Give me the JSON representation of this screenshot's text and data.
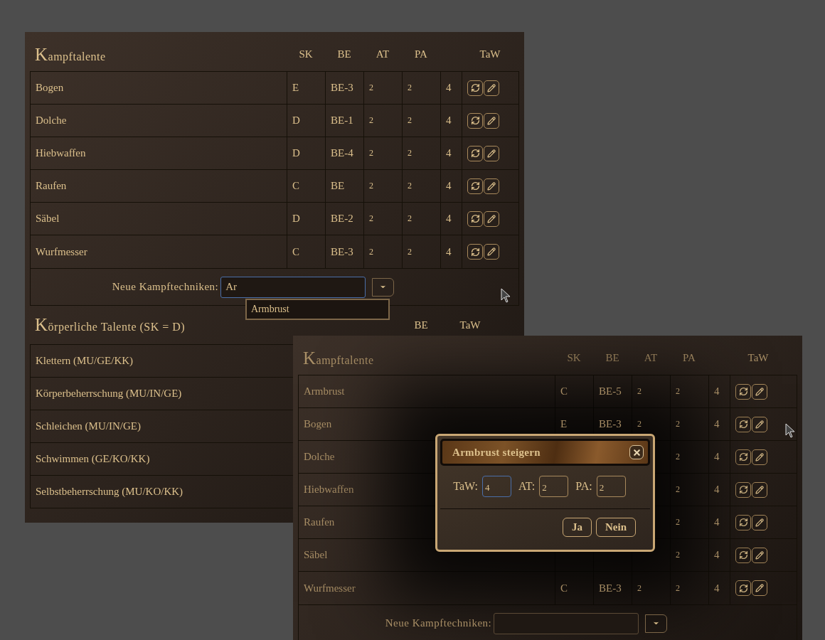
{
  "back_window": {
    "combat": {
      "title": "Kampftalente",
      "columns": [
        "SK",
        "BE",
        "AT",
        "PA",
        "TaW"
      ],
      "rows": [
        {
          "name": "Bogen",
          "sk": "E",
          "be": "BE-3",
          "at": "2",
          "pa": "2",
          "taw": "4"
        },
        {
          "name": "Dolche",
          "sk": "D",
          "be": "BE-1",
          "at": "2",
          "pa": "2",
          "taw": "4"
        },
        {
          "name": "Hiebwaffen",
          "sk": "D",
          "be": "BE-4",
          "at": "2",
          "pa": "2",
          "taw": "4"
        },
        {
          "name": "Raufen",
          "sk": "C",
          "be": "BE",
          "at": "2",
          "pa": "2",
          "taw": "4"
        },
        {
          "name": "Säbel",
          "sk": "D",
          "be": "BE-2",
          "at": "2",
          "pa": "2",
          "taw": "4"
        },
        {
          "name": "Wurfmesser",
          "sk": "C",
          "be": "BE-3",
          "at": "2",
          "pa": "2",
          "taw": "4"
        }
      ],
      "new_technique": {
        "label": "Neue Kampftechniken:",
        "value": "Ar",
        "focused": true,
        "suggestions": [
          "Armbrust"
        ]
      }
    },
    "body": {
      "title": "Körperliche Talente (SK = D)",
      "columns": [
        "BE",
        "TaW"
      ],
      "rows": [
        "Klettern (MU/GE/KK)",
        "Körperbeherrschung (MU/IN/GE)",
        "Schleichen (MU/IN/GE)",
        "Schwimmen (GE/KO/KK)",
        "Selbstbeherrschung (MU/KO/KK)"
      ]
    }
  },
  "front_window": {
    "combat": {
      "title": "Kampftalente",
      "columns": [
        "SK",
        "BE",
        "AT",
        "PA",
        "TaW"
      ],
      "rows": [
        {
          "name": "Armbrust",
          "sk": "C",
          "be": "BE-5",
          "at": "2",
          "pa": "2",
          "taw": "4"
        },
        {
          "name": "Bogen",
          "sk": "E",
          "be": "BE-3",
          "at": "2",
          "pa": "2",
          "taw": "4"
        },
        {
          "name": "Dolche",
          "pa": "2",
          "taw": "4"
        },
        {
          "name": "Hiebwaffen",
          "pa": "2",
          "taw": "4"
        },
        {
          "name": "Raufen",
          "pa": "2",
          "taw": "4"
        },
        {
          "name": "Säbel",
          "pa": "2",
          "taw": "4"
        },
        {
          "name": "Wurfmesser",
          "sk": "C",
          "be": "BE-3",
          "at": "2",
          "pa": "2",
          "taw": "4"
        }
      ],
      "new_technique": {
        "label": "Neue Kampftechniken:",
        "focused": false
      }
    }
  },
  "dialog": {
    "title": "Armbrust steigern",
    "fields": [
      {
        "label": "TaW:",
        "value": "4",
        "focused": true
      },
      {
        "label": "AT:",
        "value": "2",
        "focused": false
      },
      {
        "label": "PA:",
        "value": "2",
        "focused": false
      }
    ],
    "buttons": [
      "Ja",
      "Nein"
    ]
  }
}
